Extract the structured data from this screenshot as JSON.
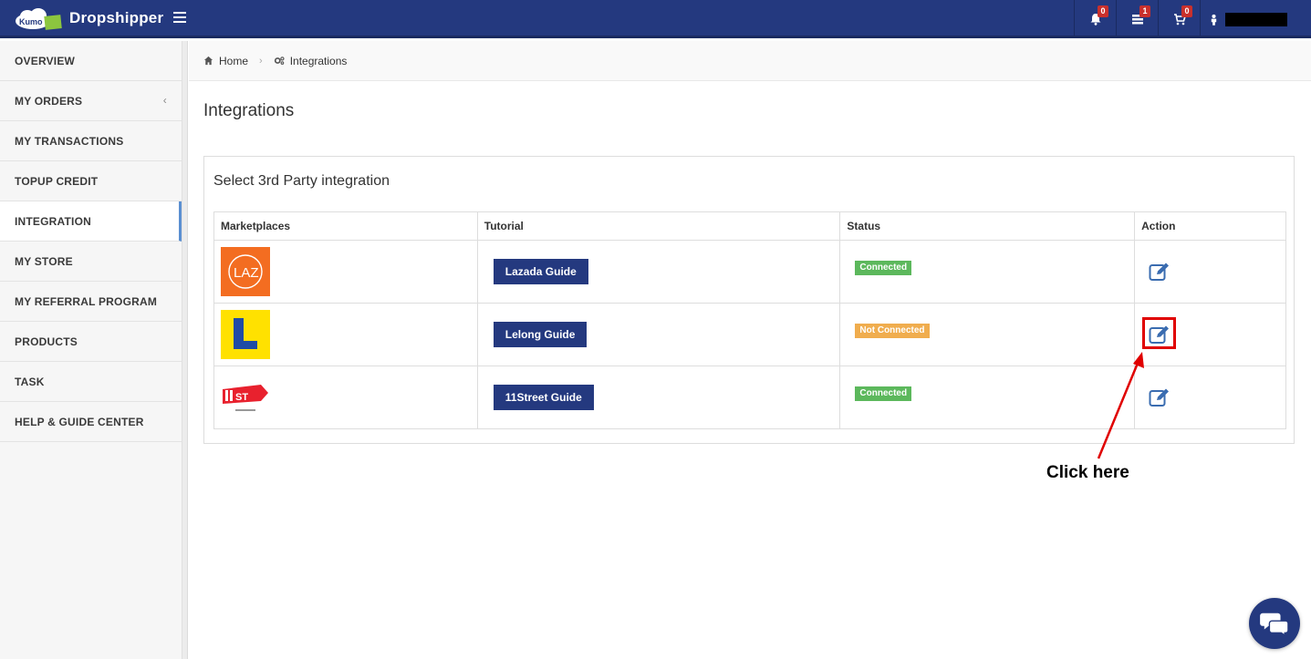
{
  "app": {
    "brand": "Dropshipper",
    "logo_text": "Kumo"
  },
  "header": {
    "notifications_count": "0",
    "messages_count": "1",
    "cart_count": "0"
  },
  "sidebar": {
    "items": [
      {
        "label": "OVERVIEW"
      },
      {
        "label": "MY ORDERS",
        "chevron": "‹"
      },
      {
        "label": "MY TRANSACTIONS"
      },
      {
        "label": "TOPUP CREDIT"
      },
      {
        "label": "INTEGRATION",
        "active": true
      },
      {
        "label": "MY STORE"
      },
      {
        "label": "MY REFERRAL PROGRAM"
      },
      {
        "label": "PRODUCTS"
      },
      {
        "label": "TASK"
      },
      {
        "label": "HELP & GUIDE CENTER"
      }
    ]
  },
  "breadcrumb": {
    "home": "Home",
    "current": "Integrations"
  },
  "page": {
    "title": "Integrations"
  },
  "panel": {
    "title": "Select 3rd Party integration",
    "columns": [
      "Marketplaces",
      "Tutorial",
      "Status",
      "Action"
    ],
    "rows": [
      {
        "logo_text": "LAZ",
        "logo_icon": "lazada-logo",
        "guide": "Lazada Guide",
        "status": "Connected"
      },
      {
        "logo_text": "L",
        "logo_icon": "lelong-logo",
        "guide": "Lelong Guide",
        "status": "Not Connected"
      },
      {
        "logo_text": "ST",
        "logo_icon": "11street-logo",
        "guide": "11Street Guide",
        "status": "Connected"
      }
    ]
  },
  "annotation": {
    "label": "Click here"
  },
  "colors": {
    "header_bg": "#24397f",
    "connected": "#5cb85c",
    "not_connected": "#f0ad4e",
    "highlight": "#e00000"
  }
}
